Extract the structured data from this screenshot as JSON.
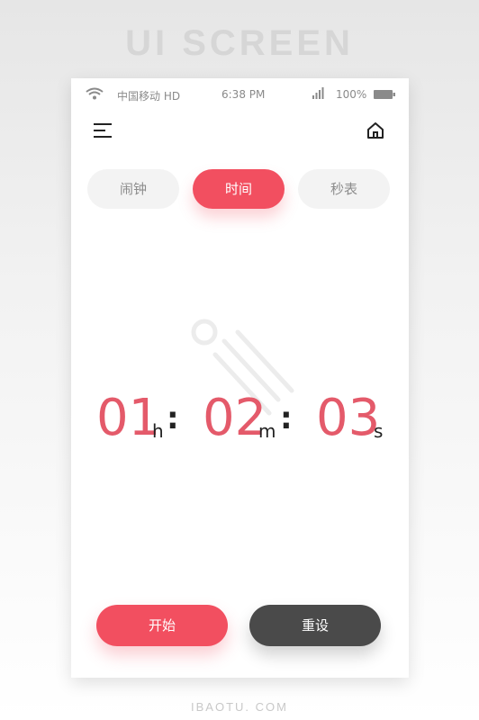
{
  "banner": {
    "text": "UI SCREEN"
  },
  "status_bar": {
    "carrier": "中国移动 HD",
    "time": "6:38 PM",
    "battery_percent": "100%",
    "icons": [
      "wifi-icon",
      "signal-icon",
      "battery-icon"
    ]
  },
  "header": {
    "menu_icon": "menu-icon",
    "home_icon": "home-icon"
  },
  "tabs": [
    {
      "label": "闹钟",
      "active": false
    },
    {
      "label": "时间",
      "active": true
    },
    {
      "label": "秒表",
      "active": false
    }
  ],
  "clock": {
    "hours": "01",
    "hours_unit": "h",
    "separator": ":",
    "minutes": "02",
    "minutes_unit": "m",
    "seconds": "03",
    "seconds_unit": "s"
  },
  "actions": {
    "start_label": "开始",
    "reset_label": "重设"
  },
  "footer": {
    "text": "IBAOTU. COM"
  },
  "colors": {
    "accent": "#f24f60",
    "digits": "#e45a6a",
    "dark_button": "#4a4a4a",
    "inactive_tab": "#f3f3f3"
  }
}
